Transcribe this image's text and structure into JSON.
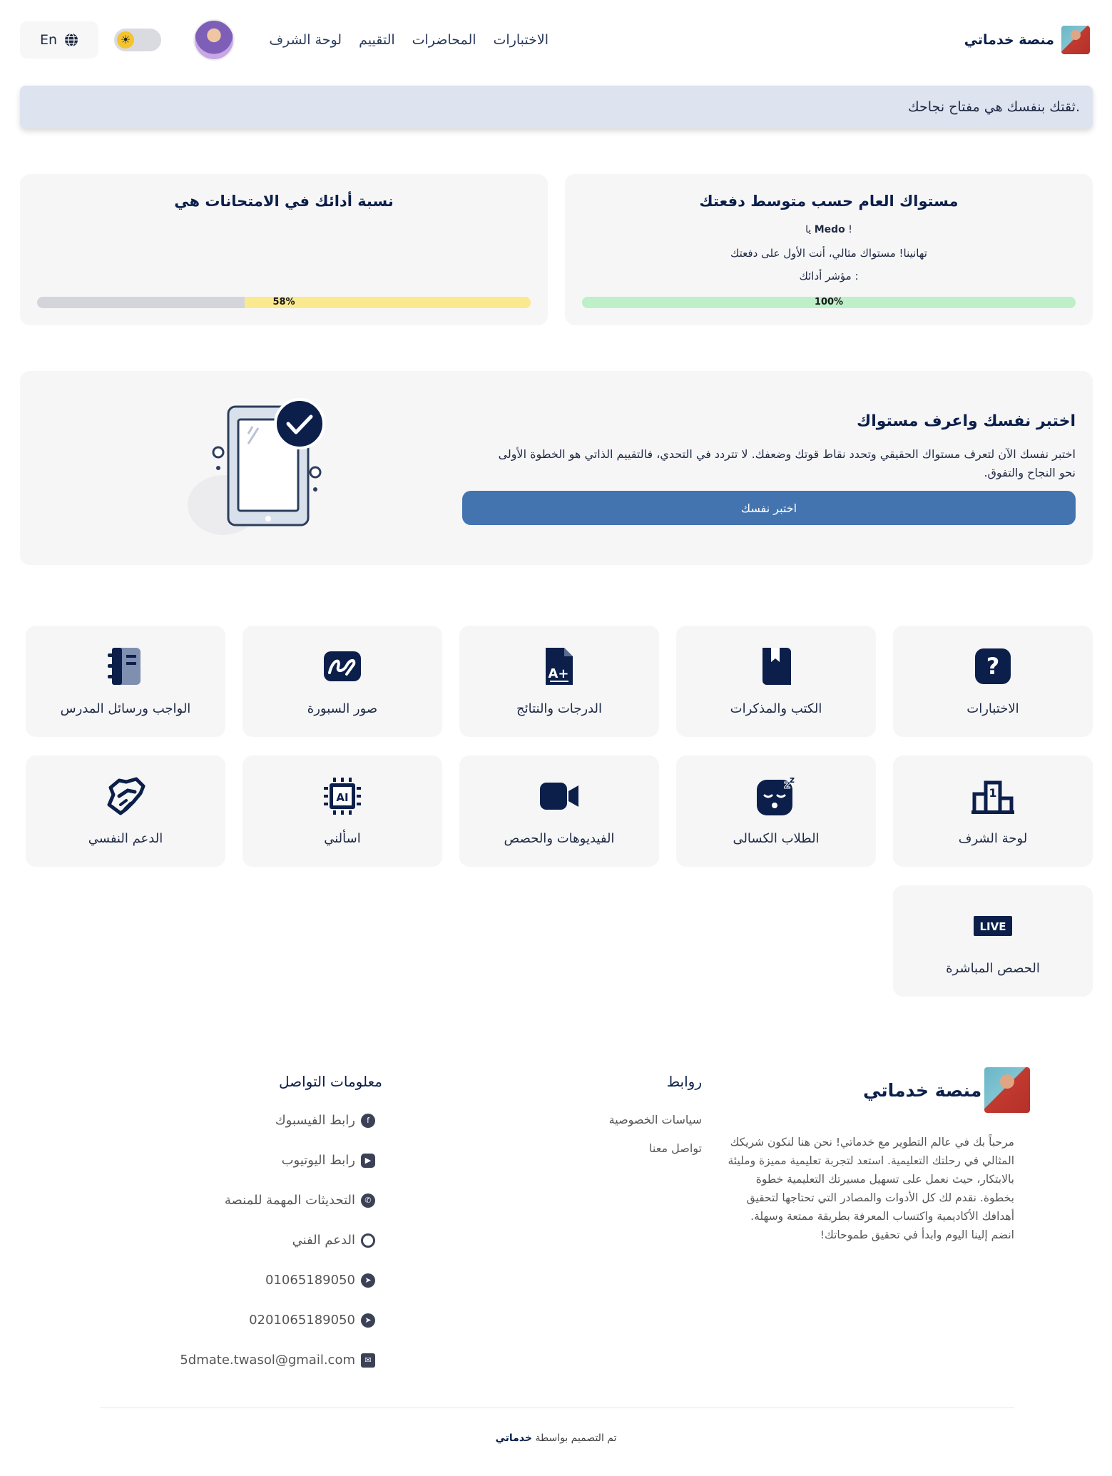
{
  "header": {
    "brand_name": "منصة خدماتي",
    "nav": [
      "الاختبارات",
      "المحاضرات",
      "التقييم",
      "لوحة الشرف"
    ],
    "lang_label": "En"
  },
  "banner": {
    "text": "ثقتك بنفسك هي مفتاح نجاحك."
  },
  "level_card": {
    "title": "مستواك العام حسب متوسط دفعتك",
    "greeting": "يا Medo !",
    "message": "تهانينا! مستواك مثالي، أنت الأول على دفعتك",
    "indicator_label": "مؤشر أدائك :",
    "progress": 100,
    "progress_label": "100%",
    "bar_color": "#bdf0c8"
  },
  "exam_card": {
    "title": "نسبة أدائك في الامتحانات هي",
    "progress": 58,
    "progress_label": "58%",
    "bar_color": "#fbe98f"
  },
  "test_section": {
    "title": "اختبر نفسك واعرف مستواك",
    "description": "اختبر نفسك الآن لتعرف مستواك الحقيقي وتحدد نقاط قوتك وضعفك. لا تتردد في التحدي، فالتقييم الذاتي هو الخطوة الأولى نحو النجاح والتفوق.",
    "button_label": "اختبر نفسك"
  },
  "tiles": [
    {
      "label": "الاختبارات",
      "icon": "question-icon"
    },
    {
      "label": "الكتب والمذكرات",
      "icon": "book-icon"
    },
    {
      "label": "الدرجات والنتائج",
      "icon": "grade-document-icon"
    },
    {
      "label": "صور السبورة",
      "icon": "signature-icon"
    },
    {
      "label": "الواجب ورسائل المدرس",
      "icon": "notebook-icon"
    },
    {
      "label": "لوحة الشرف",
      "icon": "podium-icon"
    },
    {
      "label": "الطلاب الكسالى",
      "icon": "sleepy-face-icon"
    },
    {
      "label": "الفيديوهات والحصص",
      "icon": "video-camera-icon"
    },
    {
      "label": "اسألني",
      "icon": "ai-chip-icon"
    },
    {
      "label": "الدعم النفسي",
      "icon": "handshake-icon"
    },
    {
      "label": "الحصص المباشرة",
      "icon": "live-badge-icon",
      "badge": "LIVE"
    }
  ],
  "footer": {
    "brand_name": "منصة خدماتي",
    "about": "مرحباً بك في عالم التطوير مع خدماتي! نحن هنا لنكون شريكك المثالي في رحلتك التعليمية. استعد لتجربة تعليمية مميزة ومليئة بالابتكار، حيث نعمل على تسهيل مسيرتك التعليمية خطوة بخطوة. نقدم لك كل الأدوات والمصادر التي تحتاجها لتحقيق أهدافك الأكاديمية واكتساب المعرفة بطريقة ممتعة وسهلة. انضم إلينا اليوم وابدأ في تحقيق طموحاتك!",
    "links_title": "روابط",
    "links": [
      "سياسات الخصوصية",
      "تواصل معنا"
    ],
    "contact_title": "معلومات التواصل",
    "contacts": [
      {
        "label": "رابط الفيسبوك",
        "icon": "facebook-icon"
      },
      {
        "label": "رابط اليوتيوب",
        "icon": "youtube-icon"
      },
      {
        "label": "التحديثات المهمة للمنصة",
        "icon": "whatsapp-icon"
      },
      {
        "label": "الدعم الفني",
        "icon": "support-agent-icon"
      },
      {
        "label": "01065189050",
        "icon": "telegram-icon"
      },
      {
        "label": "0201065189050",
        "icon": "telegram-icon"
      },
      {
        "label": "5dmate.twasol@gmail.com",
        "icon": "mail-icon"
      }
    ],
    "credit_prefix": "تم التصميم بواسطة",
    "credit_name": "خدماتي"
  },
  "colors": {
    "primary": "#0b1f4a",
    "button": "#4474b0",
    "banner": "#dde3ef",
    "card": "#f7f6f7"
  }
}
